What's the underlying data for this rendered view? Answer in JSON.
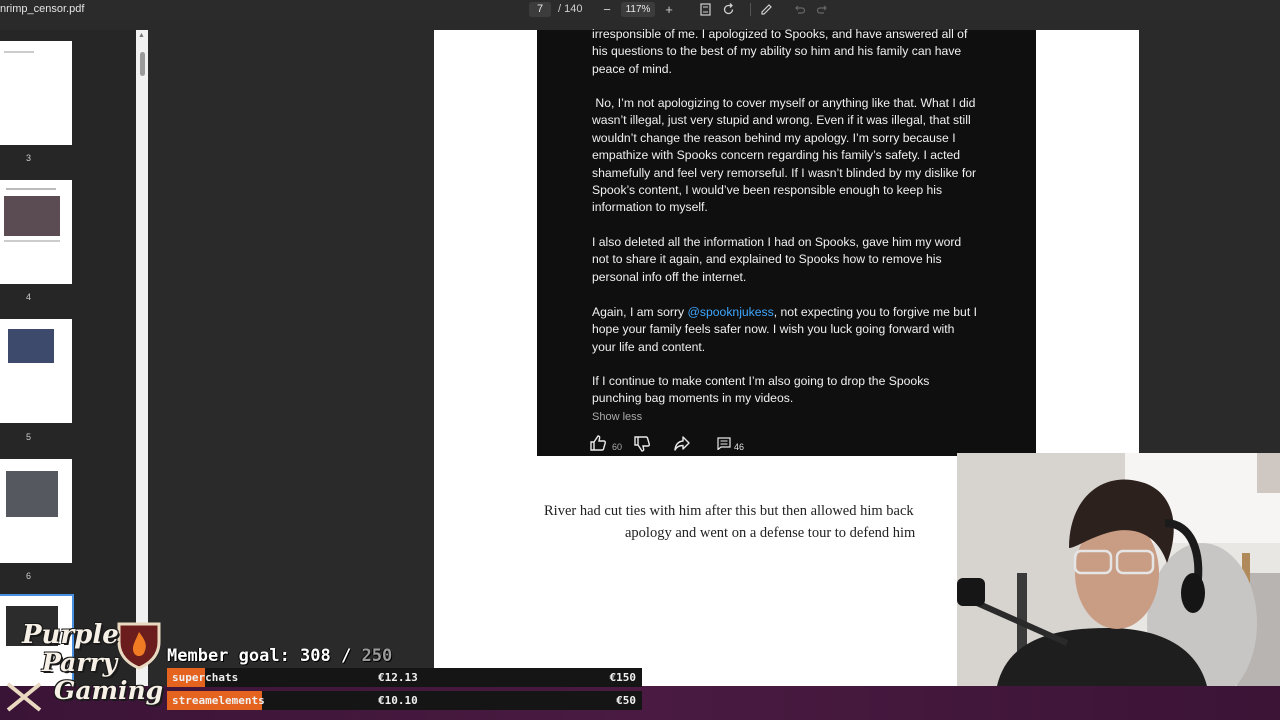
{
  "toolbar": {
    "filename": "nrimp_censor.pdf",
    "page_current": "7",
    "page_total": "/ 140",
    "zoom": "117%"
  },
  "thumbnails": {
    "page_labels": [
      "3",
      "4",
      "5",
      "6"
    ]
  },
  "comment": {
    "para1": "irresponsible of me. I apologized to Spooks, and have answered all of\nhis questions to the best of my ability so him and his family can have\npeace of mind.",
    "para2": " No, I’m not apologizing to cover myself or anything like that. What I did\nwasn’t illegal, just very stupid and wrong. Even if it was illegal, that still\nwouldn’t change the reason behind my apology. I’m sorry because I\nempathize with Spooks concern regarding his family’s safety. I acted\nshamefully and feel very remorseful. If I wasn’t blinded by my dislike for\nSpook’s content, I would’ve been responsible enough to keep his\ninformation to myself.",
    "para3": "I also deleted all the information I had on Spooks, gave him my word\nnot to share it again, and explained to Spooks how to remove his\npersonal info off the internet.",
    "para4_pre": "Again, I am sorry ",
    "para4_mention": "@spooknjukess",
    "para4_post": ", not expecting you to forgive me but I\nhope your family feels safer now. I wish you luck going forward with\nyour life and content.",
    "para5": "If I continue to make content I’m also going to drop the Spooks\npunching bag moments in my videos.",
    "show_less": "Show less",
    "like_count": "60",
    "reply_count": "46"
  },
  "page_text": {
    "line1": "River had cut ties with him after this but then allowed him back",
    "line2": "apology and went on a defense tour to defend him"
  },
  "overlay": {
    "logo_line1": "Purple",
    "logo_line2": "Parry",
    "logo_line3": "Gaming",
    "goal_prefix": "Member goal: 308 / ",
    "goal_target": "250",
    "bars": [
      {
        "label": "superchats",
        "current": "€12.13",
        "goal": "€150",
        "progress": 0.08
      },
      {
        "label": "streamelements",
        "current": "€10.10",
        "goal": "€50",
        "progress": 0.2
      }
    ]
  },
  "colors": {
    "accent_orange": "#e4631f",
    "mention_blue": "#3ea6ff"
  }
}
